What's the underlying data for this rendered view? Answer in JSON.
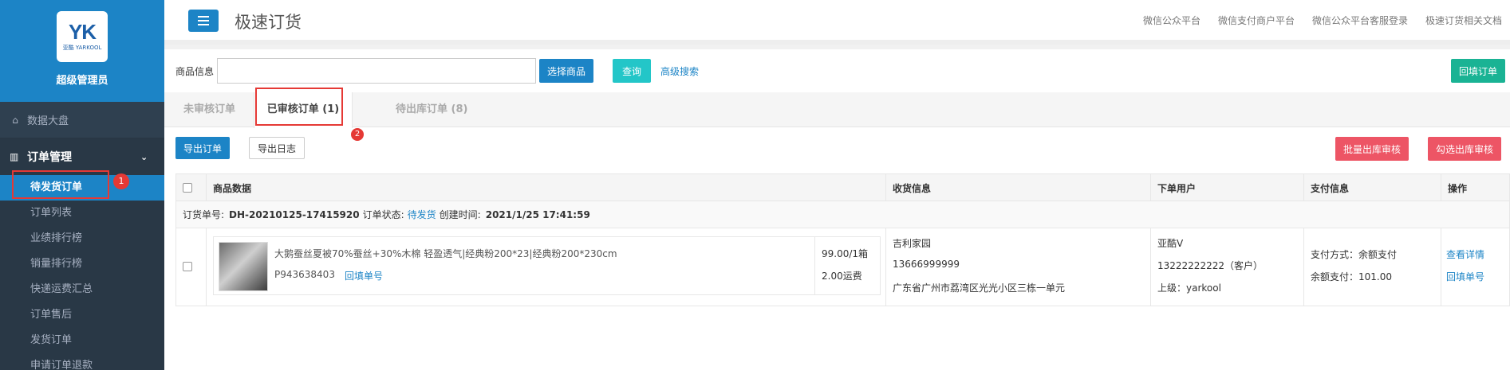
{
  "sidebar": {
    "logo_text": "YK",
    "logo_sub": "亚酷 YARKOOL",
    "admin_name": "超级管理员",
    "dashboard": "数据大盘",
    "group": "订单管理",
    "items": [
      "待发货订单",
      "订单列表",
      "业绩排行榜",
      "销量排行榜",
      "快递运费汇总",
      "订单售后",
      "发货订单",
      "申请订单退款"
    ],
    "annotation": "1"
  },
  "header": {
    "title": "极速订货",
    "links": [
      "微信公众平台",
      "微信支付商户平台",
      "微信公众平台客服登录",
      "极速订货相关文档"
    ]
  },
  "search": {
    "label": "商品信息",
    "select_button": "选择商品",
    "query_button": "查询",
    "advanced_link": "高级搜索",
    "backfill_button": "回填订单"
  },
  "tabs": [
    "未审核订单",
    "已审核订单 (1)",
    "待出库订单 (8)"
  ],
  "tab_annotation": "2",
  "actions": {
    "export_orders": "导出订单",
    "export_log": "导出日志",
    "batch_audit": "批量出库审核",
    "checked_audit": "勾选出库审核"
  },
  "table": {
    "headers": [
      "商品数据",
      "收货信息",
      "下单用户",
      "支付信息",
      "操作"
    ],
    "order": {
      "no_label": "订货单号:",
      "no": "DH-20210125-17415920",
      "status_label": "订单状态:",
      "status": "待发货",
      "time_label": "创建时间:",
      "time": "2021/1/25 17:41:59"
    },
    "product": {
      "name": "大鹅蚕丝夏被70%蚕丝+30%木棉 轻盈透气|经典粉200*23|经典粉200*230cm",
      "sku": "P943638403",
      "sku_link": "回填单号",
      "price": "99.00/1箱",
      "shipping": "2.00运费"
    },
    "receiver": {
      "name": "吉利家园",
      "phone": "13666999999",
      "address": "广东省广州市荔湾区光光小区三栋一单元"
    },
    "user": {
      "name": "亚酷V",
      "phone": "13222222222（客户）",
      "parent": "上级：yarkool"
    },
    "payment": {
      "method": "支付方式：余额支付",
      "amount": "余额支付：101.00"
    },
    "ops": [
      "查看详情",
      "回填单号"
    ]
  }
}
